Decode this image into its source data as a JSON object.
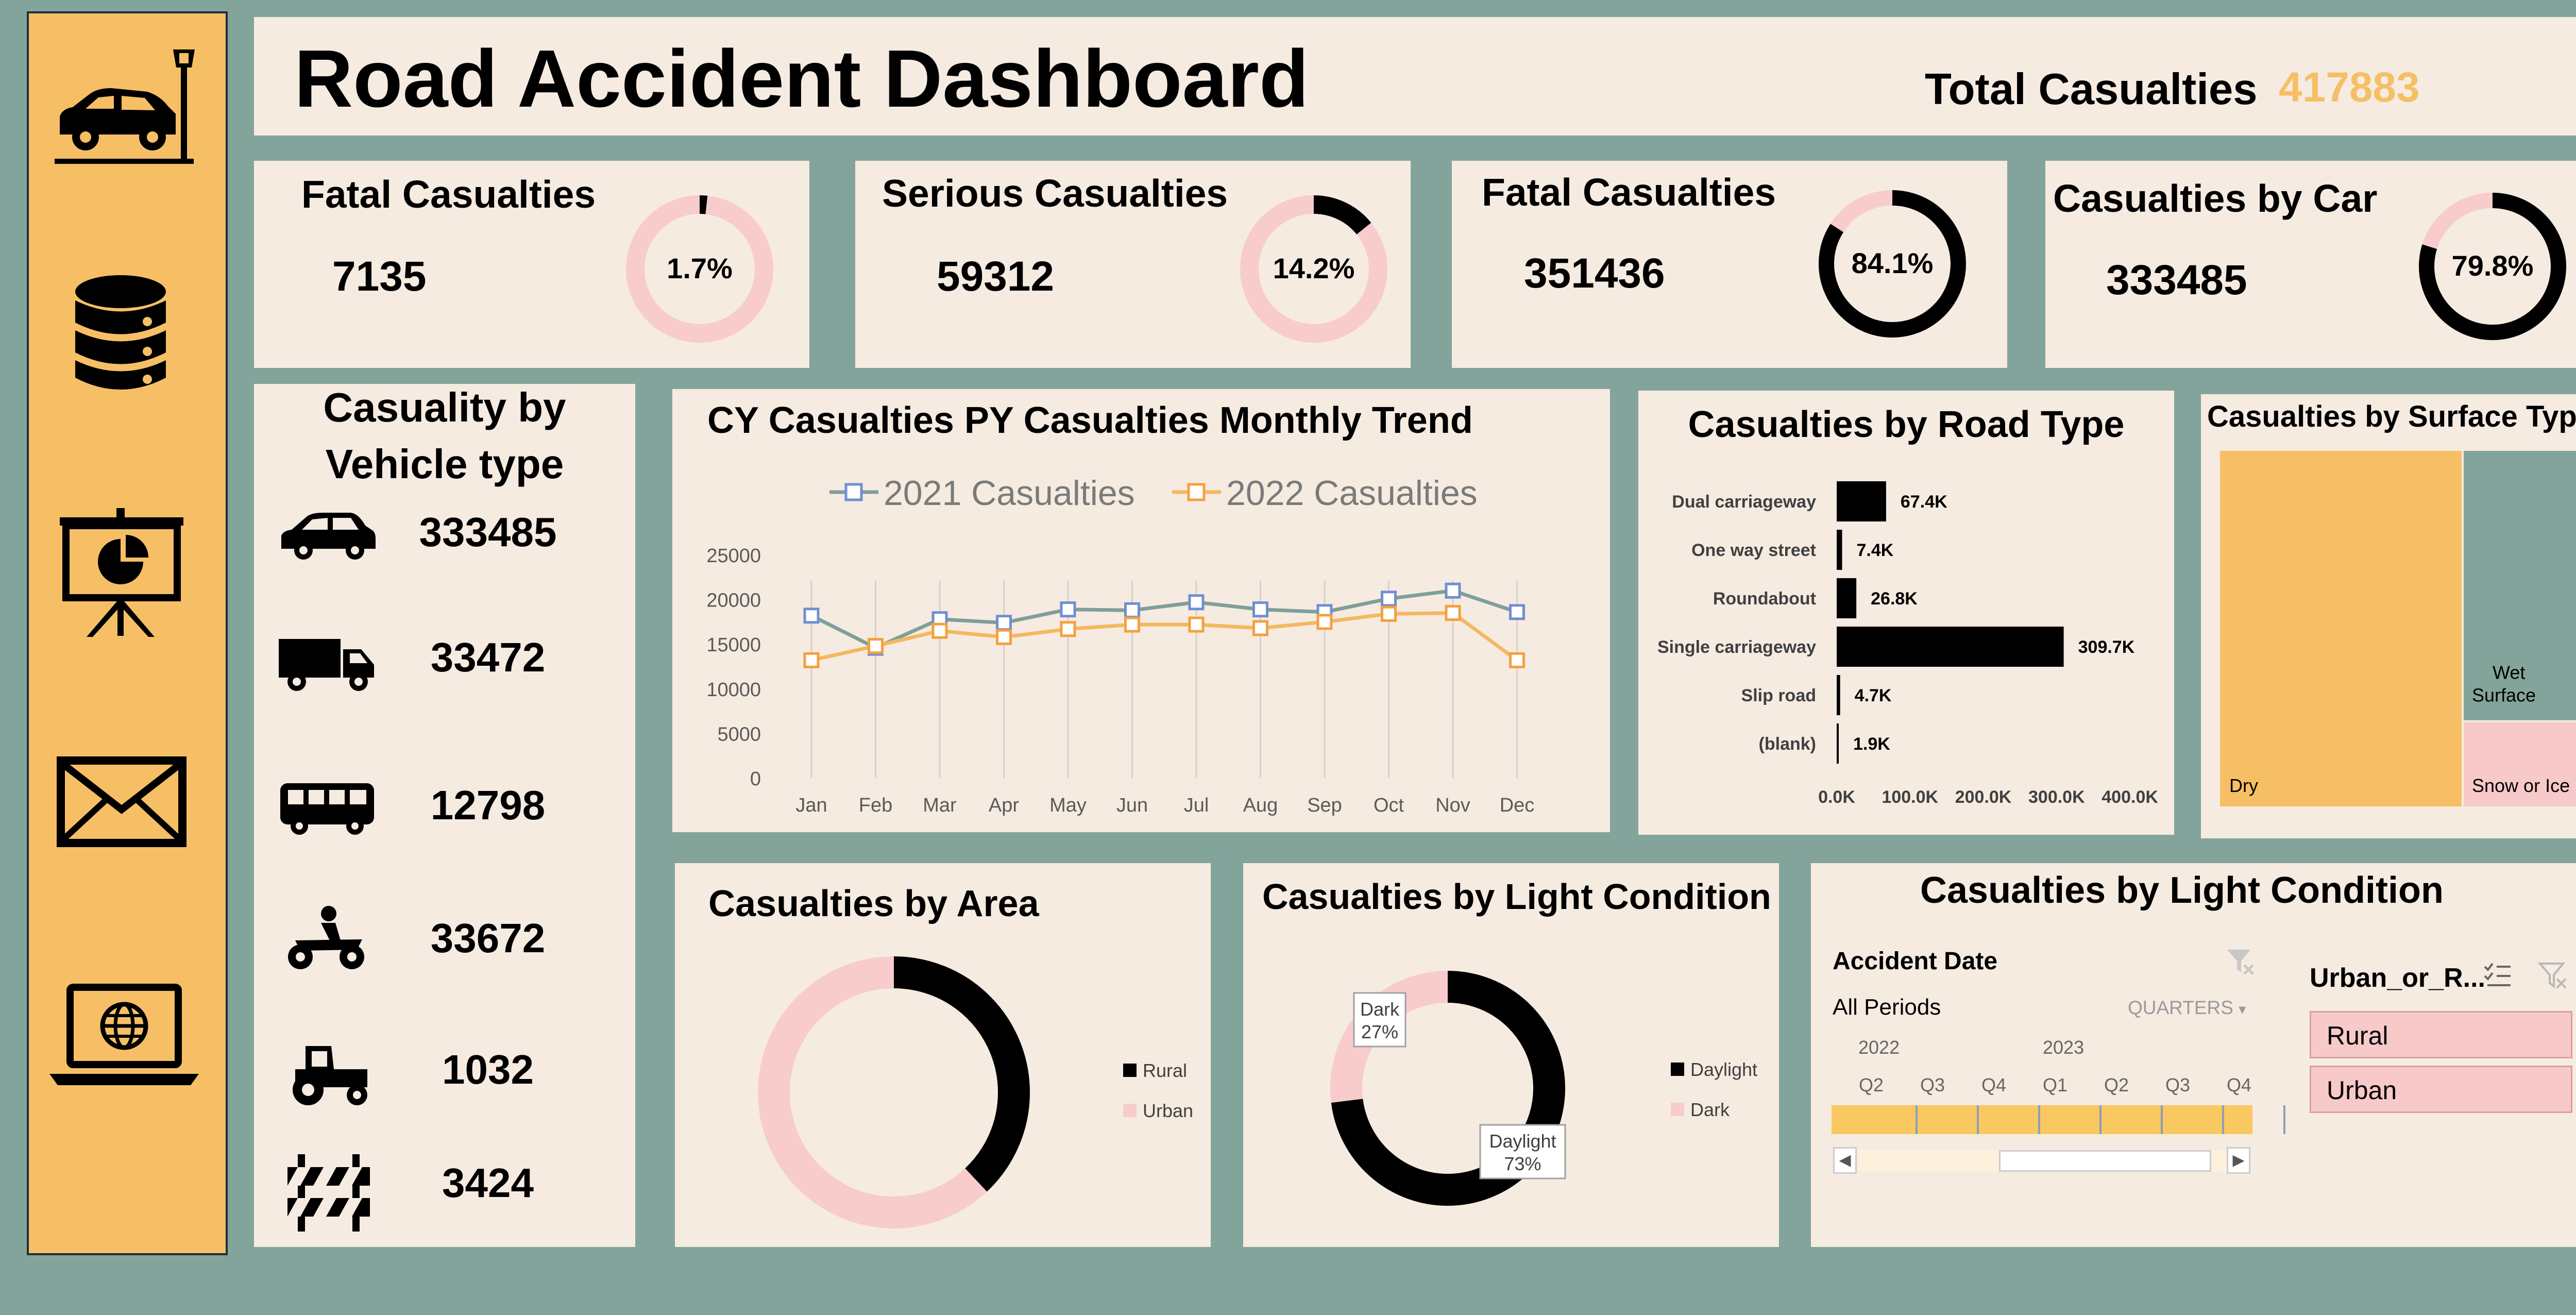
{
  "header": {
    "title": "Road Accident Dashboard",
    "total_label": "Total Casualties",
    "total_value": "417883"
  },
  "sidebar": {
    "icons": [
      "car-crash-icon",
      "database-icon",
      "presentation-icon",
      "mail-icon",
      "laptop-globe-icon"
    ]
  },
  "kpis": [
    {
      "title": "Fatal Casualties",
      "value": "7135",
      "pct_label": "1.7%",
      "pct": 1.7,
      "style": "light"
    },
    {
      "title": "Serious Casualties",
      "value": "59312",
      "pct_label": "14.2%",
      "pct": 14.2,
      "style": "light"
    },
    {
      "title": "Fatal Casualties",
      "value": "351436",
      "pct_label": "84.1%",
      "pct": 84.1,
      "style": "heavy"
    },
    {
      "title": "Casualties by Car",
      "value": "333485",
      "pct_label": "79.8%",
      "pct": 79.8,
      "style": "heavy"
    }
  ],
  "vehicle_panel": {
    "title_line1": "Casuality by",
    "title_line2": "Vehicle type",
    "rows": [
      {
        "icon": "car-icon",
        "value": "333485"
      },
      {
        "icon": "truck-icon",
        "value": "33472"
      },
      {
        "icon": "bus-icon",
        "value": "12798"
      },
      {
        "icon": "motorcycle-icon",
        "value": "33672"
      },
      {
        "icon": "tractor-icon",
        "value": "1032"
      },
      {
        "icon": "barrier-icon",
        "value": "3424"
      }
    ]
  },
  "slicer": {
    "title": "Casualties by Light Condition",
    "date_label": "Accident Date",
    "periods_label": "All Periods",
    "granularity": "QUARTERS",
    "years": [
      "2022",
      "2023"
    ],
    "quarters": [
      "Q2",
      "Q3",
      "Q4",
      "Q1",
      "Q2",
      "Q3",
      "Q4"
    ],
    "field_label": "Urban_or_R...",
    "options": [
      "Rural",
      "Urban"
    ]
  },
  "chart_data": [
    {
      "type": "line",
      "title": "CY Casualties PY Casualties Monthly Trend",
      "categories": [
        "Jan",
        "Feb",
        "Mar",
        "Apr",
        "May",
        "Jun",
        "Jul",
        "Aug",
        "Sep",
        "Oct",
        "Nov",
        "Dec"
      ],
      "series": [
        {
          "name": "2021 Casualties",
          "color": "#7f9f99",
          "values": [
            18200,
            14600,
            17800,
            17400,
            18900,
            18800,
            19700,
            18900,
            18600,
            20100,
            21000,
            18600
          ]
        },
        {
          "name": "2022 Casualties",
          "color": "#f4b860",
          "values": [
            13200,
            14800,
            16500,
            15800,
            16700,
            17200,
            17200,
            16800,
            17500,
            18400,
            18500,
            13200
          ]
        }
      ],
      "ylim": [
        0,
        25000
      ],
      "yticks": [
        "0",
        "5000",
        "10000",
        "15000",
        "20000",
        "25000"
      ],
      "legend": "top"
    },
    {
      "type": "bar",
      "title": "Casualties by Road Type",
      "orientation": "horizontal",
      "categories": [
        "Dual carriageway",
        "One way street",
        "Roundabout",
        "Single carriageway",
        "Slip road",
        "(blank)"
      ],
      "values": [
        67400,
        7400,
        26800,
        309700,
        4700,
        1900
      ],
      "data_labels": [
        "67.4K",
        "7.4K",
        "26.8K",
        "309.7K",
        "4.7K",
        "1.9K"
      ],
      "xlim": [
        0,
        400000
      ],
      "xticks": [
        "0.0K",
        "100.0K",
        "200.0K",
        "300.0K",
        "400.0K"
      ]
    },
    {
      "type": "treemap",
      "title": "Casualties by Surface Type",
      "categories": [
        "Dry",
        "Wet Surface",
        "Snow or Ice"
      ],
      "values": [
        67,
        25,
        8
      ],
      "colors": [
        "#f6bf66",
        "#83a49b",
        "#f8c9c9"
      ]
    },
    {
      "type": "pie",
      "title": "Casualties by Area",
      "categories": [
        "Rural",
        "Urban"
      ],
      "values": [
        38,
        62
      ],
      "colors": [
        "#000000",
        "#f8cccc"
      ],
      "legend": "right"
    },
    {
      "type": "pie",
      "title": "Casualties by Light Condition",
      "categories": [
        "Daylight",
        "Dark"
      ],
      "values": [
        73,
        27
      ],
      "data_labels": [
        "Daylight\n73%",
        "Dark\n27%"
      ],
      "colors": [
        "#000000",
        "#f8cccc"
      ],
      "legend": "right"
    }
  ]
}
